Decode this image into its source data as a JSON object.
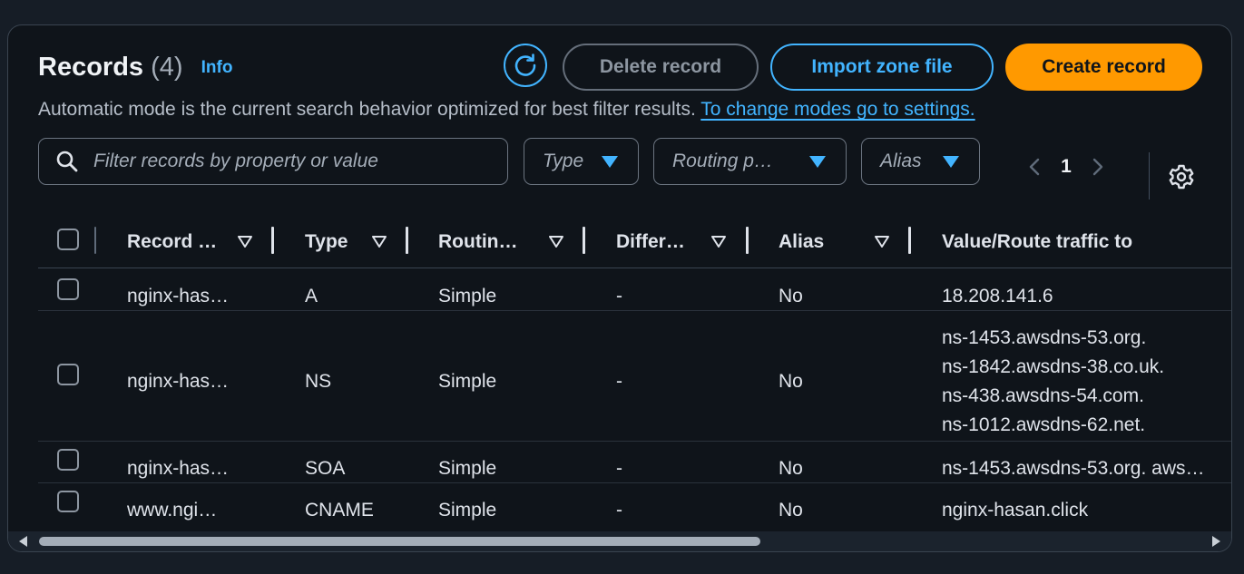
{
  "header": {
    "title": "Records",
    "count": "(4)",
    "info_link": "Info",
    "refresh_icon": "refresh-icon",
    "delete_label": "Delete record",
    "import_label": "Import zone file",
    "create_label": "Create record"
  },
  "subtitle": {
    "text": "Automatic mode is the current search behavior optimized for best filter results. ",
    "link": "To change modes go to settings."
  },
  "search": {
    "placeholder": "Filter records by property or value",
    "icon": "search-icon"
  },
  "filters": {
    "type": "Type",
    "routing": "Routing p…",
    "alias": "Alias"
  },
  "pagination": {
    "current_page": "1",
    "prev_icon": "chevron-left-icon",
    "next_icon": "chevron-right-icon",
    "settings_icon": "gear-icon"
  },
  "table": {
    "columns": [
      "Record …",
      "Type",
      "Routin…",
      "Differ…",
      "Alias",
      "Value/Route traffic to"
    ],
    "rows": [
      {
        "name": "nginx-has…",
        "type": "A",
        "routing": "Simple",
        "differ": "-",
        "alias": "No",
        "value": [
          "18.208.141.6"
        ]
      },
      {
        "name": "nginx-has…",
        "type": "NS",
        "routing": "Simple",
        "differ": "-",
        "alias": "No",
        "value": [
          "ns-1453.awsdns-53.org.",
          "ns-1842.awsdns-38.co.uk.",
          "ns-438.awsdns-54.com.",
          "ns-1012.awsdns-62.net."
        ]
      },
      {
        "name": "nginx-has…",
        "type": "SOA",
        "routing": "Simple",
        "differ": "-",
        "alias": "No",
        "value": [
          "ns-1453.awsdns-53.org. aws…"
        ]
      },
      {
        "name": "www.ngi…",
        "type": "CNAME",
        "routing": "Simple",
        "differ": "-",
        "alias": "No",
        "value": [
          "nginx-hasan.click"
        ]
      }
    ]
  },
  "colors": {
    "accent": "#42b4ff",
    "primary_button": "#ff9900",
    "background": "#0f141a"
  }
}
